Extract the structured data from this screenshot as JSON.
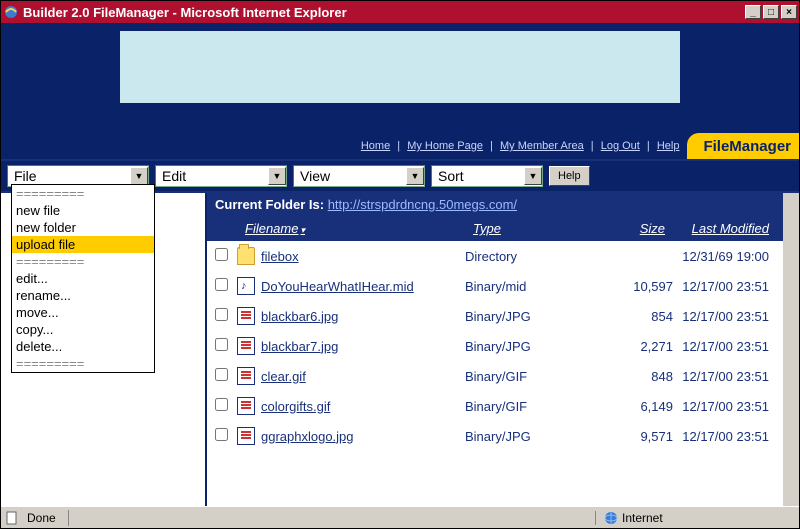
{
  "window": {
    "title": "Builder 2.0 FileManager - Microsoft Internet Explorer"
  },
  "nav": {
    "home": "Home",
    "myhome": "My Home Page",
    "member": "My Member Area",
    "logout": "Log Out",
    "help": "Help",
    "fm_label": "FileManager"
  },
  "toolbar": {
    "file": "File",
    "edit": "Edit",
    "view": "View",
    "sort": "Sort",
    "help_btn": "Help"
  },
  "file_menu": {
    "sep": "=========",
    "newfile": "new file",
    "newfolder": "new folder",
    "upload": "upload file",
    "edit": "edit...",
    "rename": "rename...",
    "move": "move...",
    "copy": "copy...",
    "delete": "delete..."
  },
  "folder": {
    "label": "Current Folder Is:",
    "url": "http://strspdrdncng.50megs.com/"
  },
  "columns": {
    "filename": "Filename",
    "type": "Type",
    "size": "Size",
    "modified": "Last Modified"
  },
  "files": [
    {
      "name": "filebox",
      "type": "Directory",
      "size": "",
      "modified": "12/31/69 19:00",
      "icon": "folder"
    },
    {
      "name": "DoYouHearWhatIHear.mid",
      "type": "Binary/mid",
      "size": "10,597",
      "modified": "12/17/00 23:51",
      "icon": "mid"
    },
    {
      "name": "blackbar6.jpg",
      "type": "Binary/JPG",
      "size": "854",
      "modified": "12/17/00 23:51",
      "icon": "file"
    },
    {
      "name": "blackbar7.jpg",
      "type": "Binary/JPG",
      "size": "2,271",
      "modified": "12/17/00 23:51",
      "icon": "file"
    },
    {
      "name": "clear.gif",
      "type": "Binary/GIF",
      "size": "848",
      "modified": "12/17/00 23:51",
      "icon": "file"
    },
    {
      "name": "colorgifts.gif",
      "type": "Binary/GIF",
      "size": "6,149",
      "modified": "12/17/00 23:51",
      "icon": "file"
    },
    {
      "name": "ggraphxlogo.jpg",
      "type": "Binary/JPG",
      "size": "9,571",
      "modified": "12/17/00 23:51",
      "icon": "file"
    }
  ],
  "status": {
    "done": "Done",
    "zone": "Internet"
  }
}
